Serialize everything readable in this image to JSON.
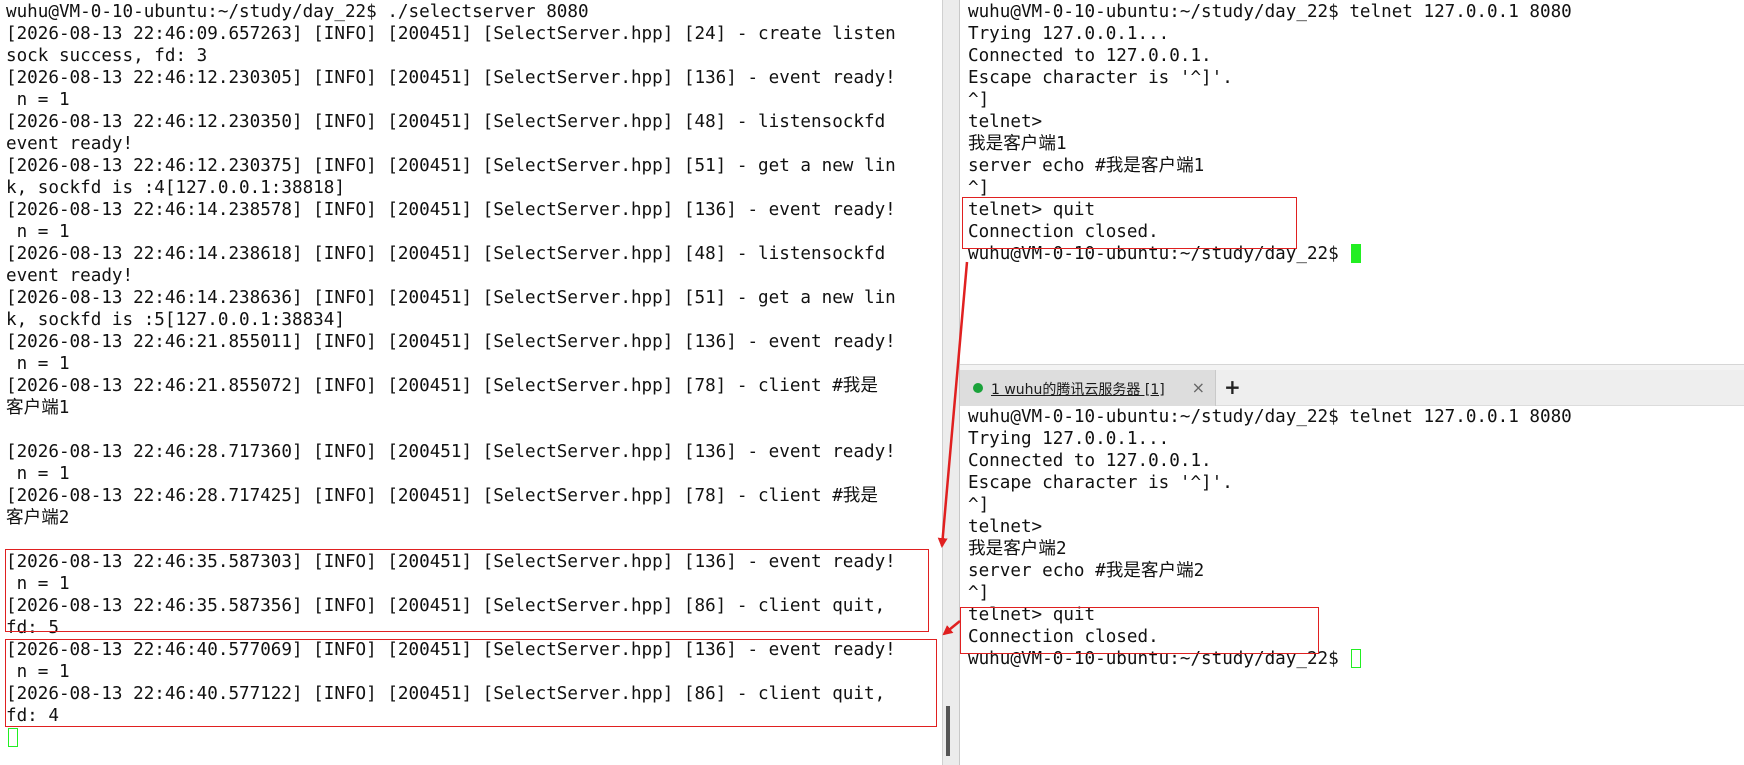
{
  "left_terminal": {
    "lines": [
      "wuhu@VM-0-10-ubuntu:~/study/day_22$ ./selectserver 8080",
      "[2026-08-13 22:46:09.657263] [INFO] [200451] [SelectServer.hpp] [24] - create listen",
      "sock success, fd: 3",
      "[2026-08-13 22:46:12.230305] [INFO] [200451] [SelectServer.hpp] [136] - event ready!",
      " n = 1",
      "[2026-08-13 22:46:12.230350] [INFO] [200451] [SelectServer.hpp] [48] - listensockfd",
      "event ready!",
      "[2026-08-13 22:46:12.230375] [INFO] [200451] [SelectServer.hpp] [51] - get a new lin",
      "k, sockfd is :4[127.0.0.1:38818]",
      "[2026-08-13 22:46:14.238578] [INFO] [200451] [SelectServer.hpp] [136] - event ready!",
      " n = 1",
      "[2026-08-13 22:46:14.238618] [INFO] [200451] [SelectServer.hpp] [48] - listensockfd",
      "event ready!",
      "[2026-08-13 22:46:14.238636] [INFO] [200451] [SelectServer.hpp] [51] - get a new lin",
      "k, sockfd is :5[127.0.0.1:38834]",
      "[2026-08-13 22:46:21.855011] [INFO] [200451] [SelectServer.hpp] [136] - event ready!",
      " n = 1",
      "[2026-08-13 22:46:21.855072] [INFO] [200451] [SelectServer.hpp] [78] - client #我是",
      "客户端1",
      "",
      "[2026-08-13 22:46:28.717360] [INFO] [200451] [SelectServer.hpp] [136] - event ready!",
      " n = 1",
      "[2026-08-13 22:46:28.717425] [INFO] [200451] [SelectServer.hpp] [78] - client #我是",
      "客户端2",
      "",
      "[2026-08-13 22:46:35.587303] [INFO] [200451] [SelectServer.hpp] [136] - event ready!",
      " n = 1",
      "[2026-08-13 22:46:35.587356] [INFO] [200451] [SelectServer.hpp] [86] - client quit,",
      "fd: 5",
      "[2026-08-13 22:46:40.577069] [INFO] [200451] [SelectServer.hpp] [136] - event ready!",
      " n = 1",
      "[2026-08-13 22:46:40.577122] [INFO] [200451] [SelectServer.hpp] [86] - client quit,",
      "fd: 4"
    ]
  },
  "right_top_terminal": {
    "lines": [
      "wuhu@VM-0-10-ubuntu:~/study/day_22$ telnet 127.0.0.1 8080",
      "Trying 127.0.0.1...",
      "Connected to 127.0.0.1.",
      "Escape character is '^]'.",
      "^]",
      "telnet>",
      "我是客户端1",
      "server echo #我是客户端1",
      "^]",
      "telnet> quit",
      "Connection closed."
    ],
    "prompt": "wuhu@VM-0-10-ubuntu:~/study/day_22$ "
  },
  "tab_bar": {
    "tab_label": "1 wuhu的腾讯云服务器 [1]",
    "close_glyph": "×",
    "add_glyph": "+"
  },
  "right_bottom_terminal": {
    "lines": [
      "wuhu@VM-0-10-ubuntu:~/study/day_22$ telnet 127.0.0.1 8080",
      "Trying 127.0.0.1...",
      "Connected to 127.0.0.1.",
      "Escape character is '^]'.",
      "^]",
      "telnet>",
      "我是客户端2",
      "server echo #我是客户端2",
      "^]",
      "telnet> quit",
      "Connection closed."
    ],
    "prompt": "wuhu@VM-0-10-ubuntu:~/study/day_22$ "
  },
  "colors": {
    "annotation_red": "#e02020",
    "cursor_green": "#22ee22",
    "tab_dot_green": "#1aa23a"
  }
}
